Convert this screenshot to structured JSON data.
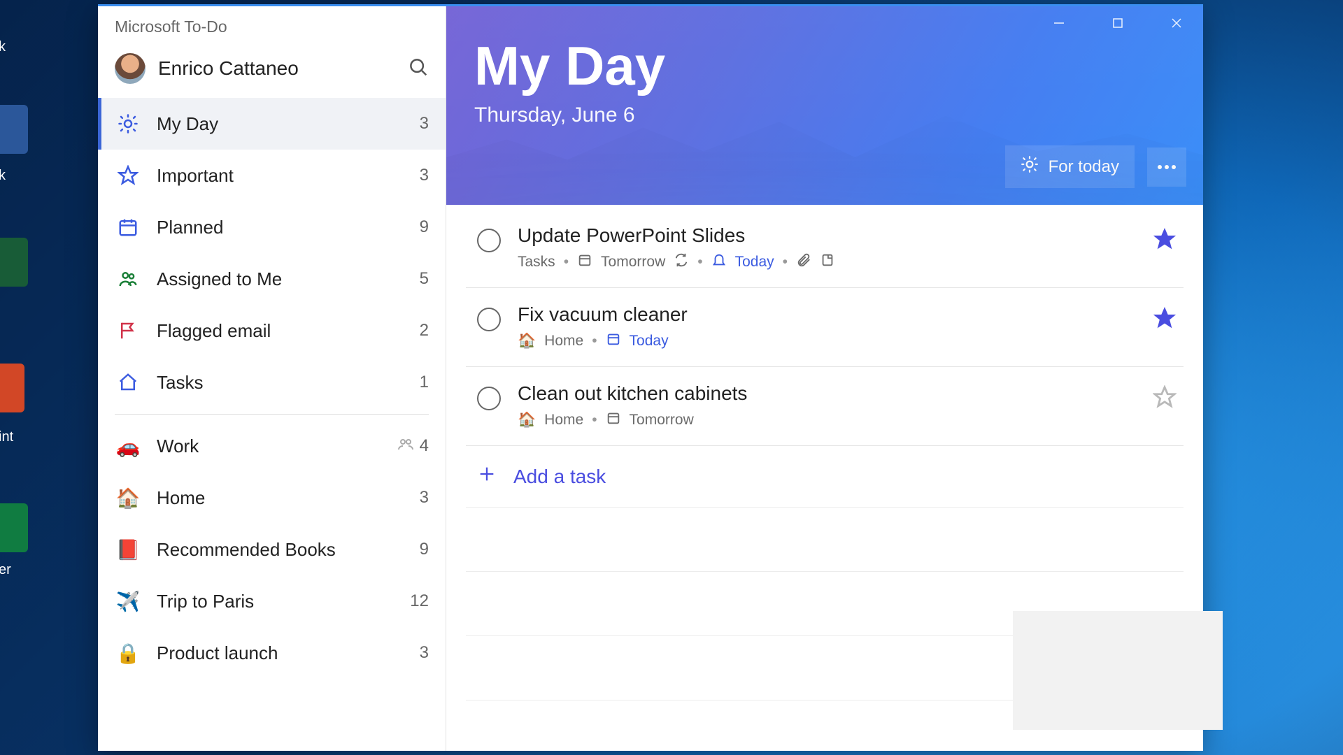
{
  "app": {
    "title": "Microsoft To-Do"
  },
  "user": {
    "name": "Enrico Cattaneo"
  },
  "hero": {
    "title": "My Day",
    "date": "Thursday, June 6",
    "for_today": "For today"
  },
  "sidebar": {
    "smart": [
      {
        "icon": "sun",
        "label": "My Day",
        "count": "3",
        "active": true
      },
      {
        "icon": "star",
        "label": "Important",
        "count": "3"
      },
      {
        "icon": "calendar",
        "label": "Planned",
        "count": "9"
      },
      {
        "icon": "assigned",
        "label": "Assigned to Me",
        "count": "5"
      },
      {
        "icon": "flag",
        "label": "Flagged email",
        "count": "2"
      },
      {
        "icon": "home",
        "label": "Tasks",
        "count": "1"
      }
    ],
    "lists": [
      {
        "emoji": "🚗",
        "label": "Work",
        "count": "4",
        "shared": true
      },
      {
        "emoji": "🏠",
        "label": "Home",
        "count": "3"
      },
      {
        "emoji": "📕",
        "label": "Recommended Books",
        "count": "9"
      },
      {
        "emoji": "✈️",
        "label": "Trip to Paris",
        "count": "12"
      },
      {
        "emoji": "🔒",
        "label": "Product launch",
        "count": "3"
      }
    ]
  },
  "tasks": [
    {
      "title": "Update PowerPoint Slides",
      "list": "Tasks",
      "list_emoji": "",
      "due": "Tomorrow",
      "repeat": true,
      "reminder": "Today",
      "attachment": true,
      "note": true,
      "starred": true
    },
    {
      "title": "Fix vacuum cleaner",
      "list": "Home",
      "list_emoji": "🏠",
      "due": "Today",
      "due_blue": true,
      "starred": true
    },
    {
      "title": "Clean out kitchen cabinets",
      "list": "Home",
      "list_emoji": "🏠",
      "due": "Tomorrow",
      "starred": false
    }
  ],
  "add_task": {
    "label": "Add a task"
  },
  "desktop_labels": {
    "k": "k",
    "int": "int",
    "er": "er"
  }
}
